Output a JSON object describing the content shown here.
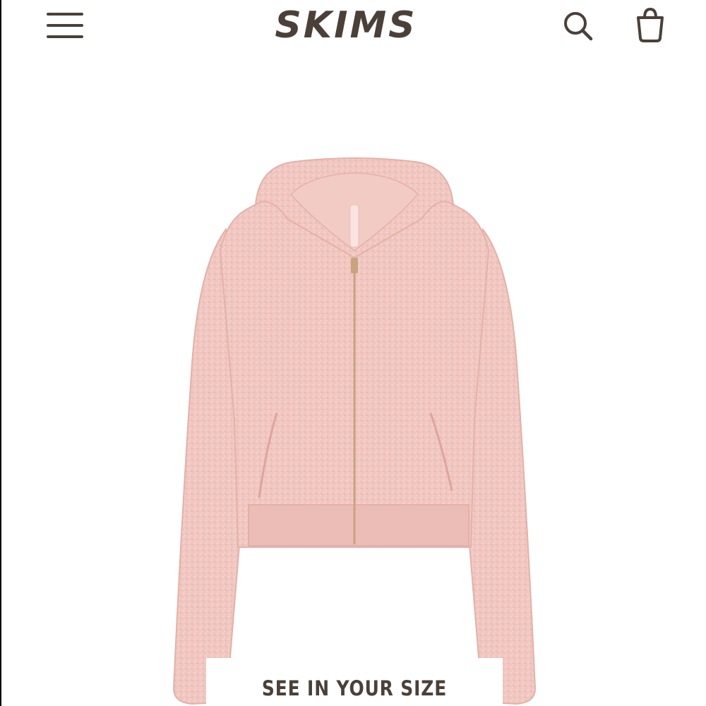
{
  "header": {
    "brand": "SKIMS",
    "menu_icon": "hamburger-menu-icon",
    "search_icon": "search-icon",
    "bag_icon": "shopping-bag-icon"
  },
  "product": {
    "image_icon": "zip-up-hoodie-image",
    "color": "#f1c6c0",
    "zipper_color": "#c9a37f"
  },
  "cta": {
    "label": "SEE IN YOUR SIZE"
  },
  "colors": {
    "brand": "#4b4039",
    "background": "#ffffff"
  }
}
